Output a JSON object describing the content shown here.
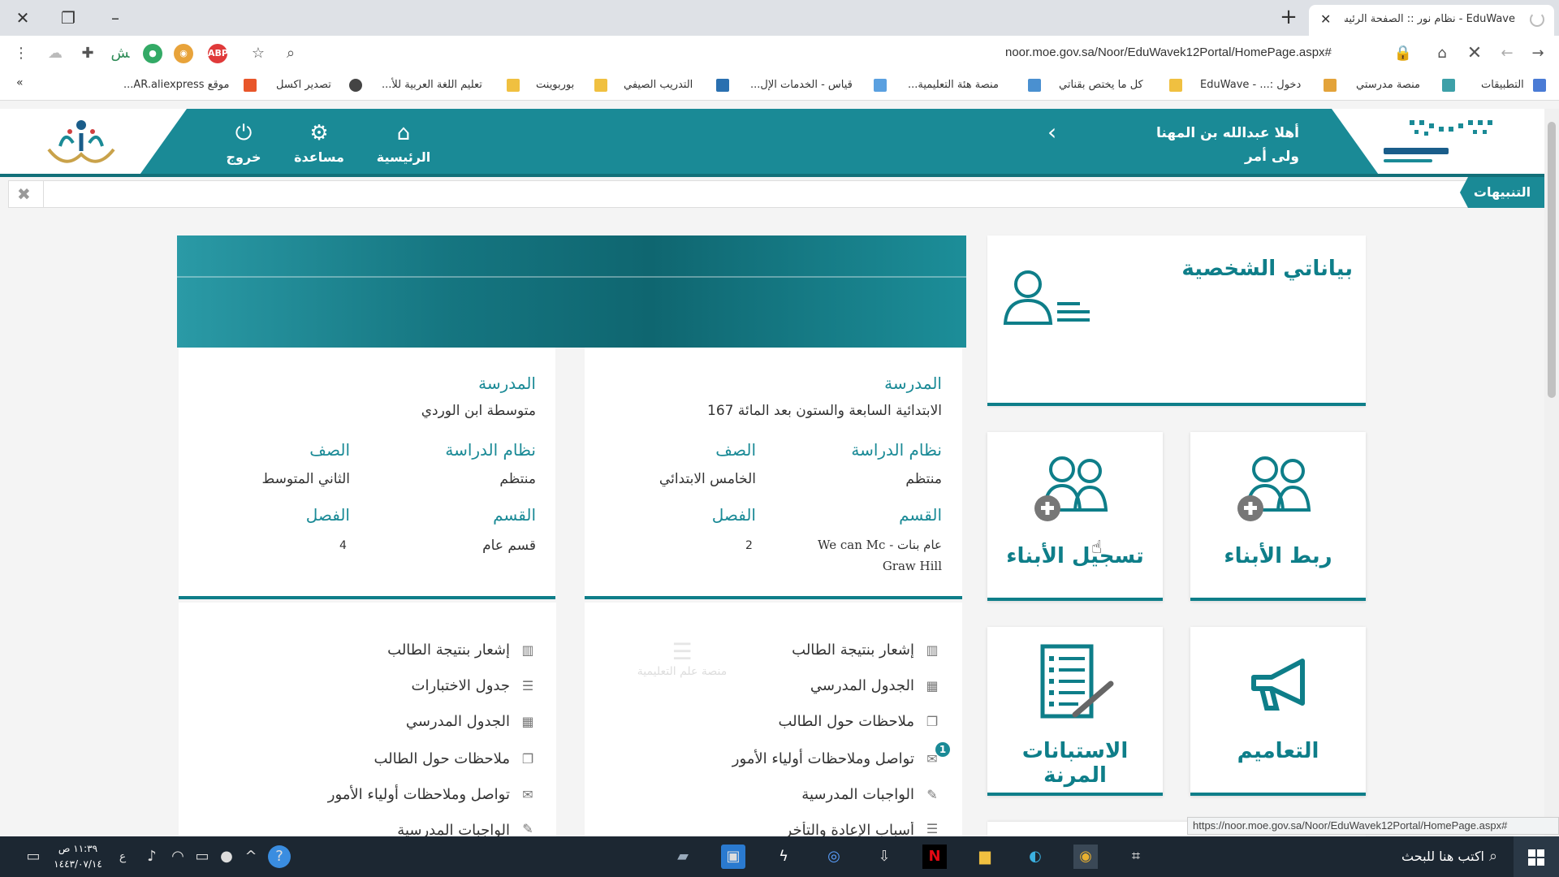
{
  "browser": {
    "tab_title": "EduWave - نظام نور :: الصفحة الرئيسية",
    "url": "noor.moe.gov.sa/Noor/EduWavek12Portal/HomePage.aspx#",
    "bookmarks": [
      "التطبيقات",
      "منصة مدرستي",
      "دخول :... - EduWave",
      "كل ما يختص بقناتي",
      "منصة هئة التعليمية...",
      "قياس - الخدمات الإل...",
      "التدريب الصيفي",
      "بوربوينت",
      "تعليم اللغة العربية للأ...",
      "تصدير اكسل",
      "موقع AR.aliexpress..."
    ],
    "status_url": "https://noor.moe.gov.sa/Noor/EduWavek12Portal/HomePage.aspx#"
  },
  "header": {
    "nav": [
      {
        "label": "الرئيسية",
        "icon": "home-icon"
      },
      {
        "label": "مساعدة",
        "icon": "gear-icon"
      },
      {
        "label": "خروج",
        "icon": "power-icon"
      }
    ],
    "welcome_line1": "أهلا عبدالله بن المهنا",
    "welcome_line2": "ولى أمر"
  },
  "notice": {
    "tag": "التنبيهات"
  },
  "profile_card": {
    "title": "بياناتي الشخصية"
  },
  "children": [
    {
      "school_label": "المدرسة",
      "school": "الابتدائية السابعة والستون بعد المائة 167",
      "system_label": "نظام الدراسة",
      "system": "منتظم",
      "grade_label": "الصف",
      "grade": "الخامس الابتدائي",
      "section_label": "القسم",
      "section_line1": "عام بنات - We can Mc",
      "section_line2": "Graw Hill",
      "class_label": "الفصل",
      "class": "2",
      "links": [
        "إشعار بنتيجة الطالب",
        "الجدول المدرسي",
        "ملاحظات حول الطالب",
        "تواصل وملاحظات أولياء الأمور",
        "الواجبات المدرسية",
        "أسباب الإعادة والتأخر"
      ],
      "badge": "1",
      "watermark": "منصة علم التعليمية"
    },
    {
      "school_label": "المدرسة",
      "school": "متوسطة ابن الوردي",
      "system_label": "نظام الدراسة",
      "system": "منتظم",
      "grade_label": "الصف",
      "grade": "الثاني المتوسط",
      "section_label": "القسم",
      "section_line1": "قسم عام",
      "class_label": "الفصل",
      "class": "4",
      "links": [
        "إشعار بنتيجة الطالب",
        "جدول الاختبارات",
        "الجدول المدرسي",
        "ملاحظات حول الطالب",
        "تواصل وملاحظات أولياء الأمور",
        "الواجبات المدرسية"
      ]
    }
  ],
  "tiles": [
    {
      "label": "ربط الأبناء",
      "icon": "link-children-icon"
    },
    {
      "label": "تسجيل الأبناء",
      "icon": "register-children-icon"
    },
    {
      "label": "التعاميم",
      "icon": "megaphone-icon"
    },
    {
      "label": "الاستبانات المرنة",
      "icon": "survey-icon"
    }
  ],
  "taskbar": {
    "search_placeholder": "اكتب هنا للبحث",
    "time": "١١:٣٩ ص",
    "date": "١٤٤٣/٠٧/١٤",
    "lang": "ع"
  },
  "colors": {
    "teal": "#1a8a96",
    "teal_dark": "#0e7e89"
  }
}
